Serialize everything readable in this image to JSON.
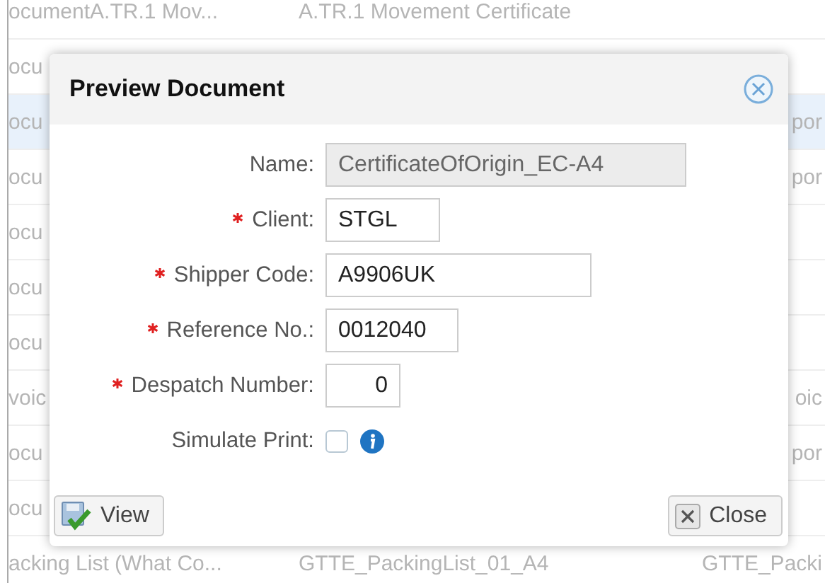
{
  "background_table": {
    "rows": [
      {
        "column_1": "ocumentA.TR.1 Mov...",
        "column_2": "A.TR.1 Movement Certificate",
        "selected": false
      },
      {
        "column_1": "ocu",
        "selected": false
      },
      {
        "column_1": "ocu",
        "column_3": "por",
        "selected": true
      },
      {
        "column_1": "ocu",
        "column_3": "por",
        "selected": false
      },
      {
        "column_1": "ocu",
        "selected": false
      },
      {
        "column_1": "ocu",
        "selected": false
      },
      {
        "column_1": "ocu",
        "selected": false
      },
      {
        "column_1": "voic",
        "column_3": "oic",
        "selected": false
      },
      {
        "column_1": "ocu",
        "column_3": "por",
        "selected": false
      },
      {
        "column_1": "ocu",
        "selected": false
      },
      {
        "column_1": "acking List (What Co...",
        "column_2": "GTTE_PackingList_01_A4",
        "column_3": "GTTE_Packi",
        "selected": false
      }
    ]
  },
  "dialog": {
    "title": "Preview Document",
    "fields": [
      {
        "kind": "text",
        "label": "Name:",
        "value": "CertificateOfOrigin_EC-A4",
        "required": false,
        "disabled": true
      },
      {
        "kind": "text",
        "label": "Client:",
        "value": "STGL",
        "required": true,
        "disabled": false
      },
      {
        "kind": "text",
        "label": "Shipper Code:",
        "value": "A9906UK",
        "required": true,
        "disabled": false
      },
      {
        "kind": "text",
        "label": "Reference No.:",
        "value": "0012040",
        "required": true,
        "disabled": false
      },
      {
        "kind": "number",
        "label": "Despatch Number:",
        "value": "0",
        "required": true,
        "disabled": false
      },
      {
        "kind": "checkbox",
        "label": "Simulate Print:",
        "checked": false,
        "info": true
      }
    ],
    "buttons": [
      {
        "kind": "view",
        "label": "View"
      },
      {
        "kind": "close",
        "label": "Close"
      }
    ]
  }
}
